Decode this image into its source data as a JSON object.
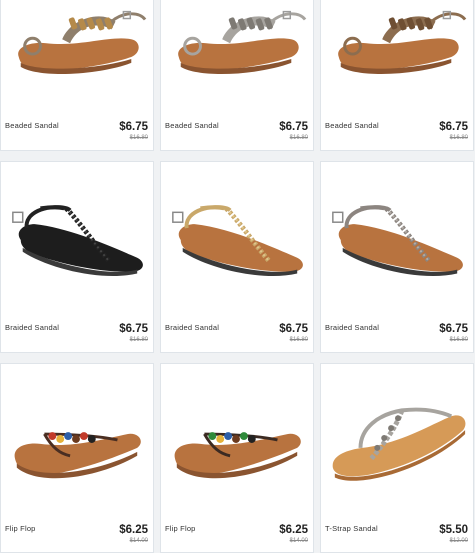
{
  "products": [
    {
      "name": "Beaded Sandal",
      "price": "$6.75",
      "original_price": "$16.80",
      "style": "beaded-toe-ring",
      "colors": {
        "sole": "#b8733f",
        "strap": "#8f7f6c",
        "accent": "#b58a4a"
      }
    },
    {
      "name": "Beaded Sandal",
      "price": "$6.75",
      "original_price": "$16.80",
      "style": "beaded-toe-ring",
      "colors": {
        "sole": "#b8733f",
        "strap": "#a7a49f",
        "accent": "#7e7a74"
      }
    },
    {
      "name": "Beaded Sandal",
      "price": "$6.75",
      "original_price": "$16.80",
      "style": "beaded-toe-ring",
      "colors": {
        "sole": "#b8733f",
        "strap": "#8c6d4f",
        "accent": "#6f4f33"
      }
    },
    {
      "name": "Braided Sandal",
      "price": "$6.75",
      "original_price": "$16.80",
      "style": "braided-tstrap",
      "colors": {
        "sole": "#1d1d1d",
        "strap": "#222222",
        "accent": "#444444"
      }
    },
    {
      "name": "Braided Sandal",
      "price": "$6.75",
      "original_price": "$16.80",
      "style": "braided-tstrap",
      "colors": {
        "sole": "#b8733f",
        "strap": "#c9a86a",
        "accent": "#e0c58b"
      }
    },
    {
      "name": "Braided Sandal",
      "price": "$6.75",
      "original_price": "$16.80",
      "style": "braided-tstrap",
      "colors": {
        "sole": "#b8733f",
        "strap": "#8c8580",
        "accent": "#b2aca6"
      }
    },
    {
      "name": "Flip Flop",
      "price": "$6.25",
      "original_price": "$14.00",
      "style": "flip-flop",
      "colors": {
        "sole": "#b8733f",
        "strap": "#4a2e22",
        "accent": "#c23b2a"
      }
    },
    {
      "name": "Flip Flop",
      "price": "$6.25",
      "original_price": "$14.00",
      "style": "flip-flop",
      "colors": {
        "sole": "#b8733f",
        "strap": "#3b2a22",
        "accent": "#2f8a3a"
      }
    },
    {
      "name": "T-Strap Sandal",
      "price": "$5.50",
      "original_price": "$12.00",
      "style": "tstrap",
      "colors": {
        "sole": "#d69a57",
        "strap": "#a7a49f",
        "accent": "#7e7a74"
      }
    }
  ]
}
